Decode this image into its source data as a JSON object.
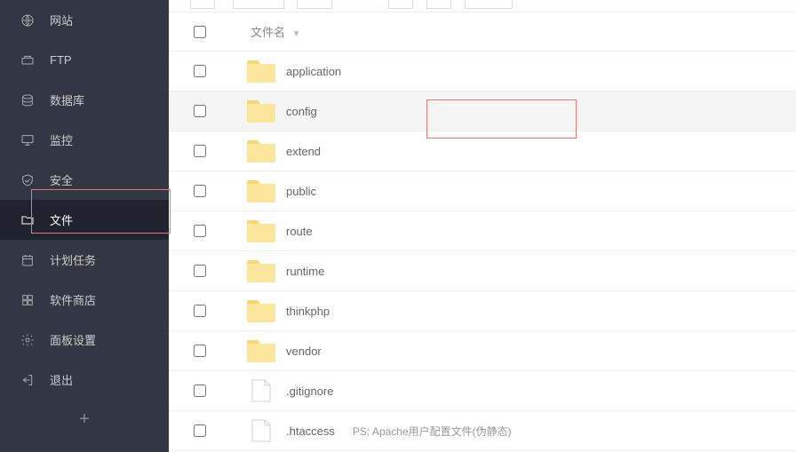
{
  "sidebar": {
    "items": [
      {
        "id": "website",
        "label": "网站"
      },
      {
        "id": "ftp",
        "label": "FTP"
      },
      {
        "id": "database",
        "label": "数据库"
      },
      {
        "id": "monitor",
        "label": "监控"
      },
      {
        "id": "security",
        "label": "安全"
      },
      {
        "id": "files",
        "label": "文件"
      },
      {
        "id": "cron",
        "label": "计划任务"
      },
      {
        "id": "softshop",
        "label": "软件商店"
      },
      {
        "id": "panel",
        "label": "面板设置"
      },
      {
        "id": "exit",
        "label": "退出"
      }
    ],
    "active_index": 5
  },
  "table": {
    "header_filename": "文件名",
    "rows": [
      {
        "type": "folder",
        "name": "application",
        "selected": false
      },
      {
        "type": "folder",
        "name": "config",
        "selected": true
      },
      {
        "type": "folder",
        "name": "extend",
        "selected": false
      },
      {
        "type": "folder",
        "name": "public",
        "selected": false
      },
      {
        "type": "folder",
        "name": "route",
        "selected": false
      },
      {
        "type": "folder",
        "name": "runtime",
        "selected": false
      },
      {
        "type": "folder",
        "name": "thinkphp",
        "selected": false
      },
      {
        "type": "folder",
        "name": "vendor",
        "selected": false
      },
      {
        "type": "file",
        "name": ".gitignore",
        "selected": false
      },
      {
        "type": "file",
        "name": ".htaccess",
        "note": "PS: Apache用户配置文件(伪静态)",
        "selected": false
      }
    ]
  }
}
